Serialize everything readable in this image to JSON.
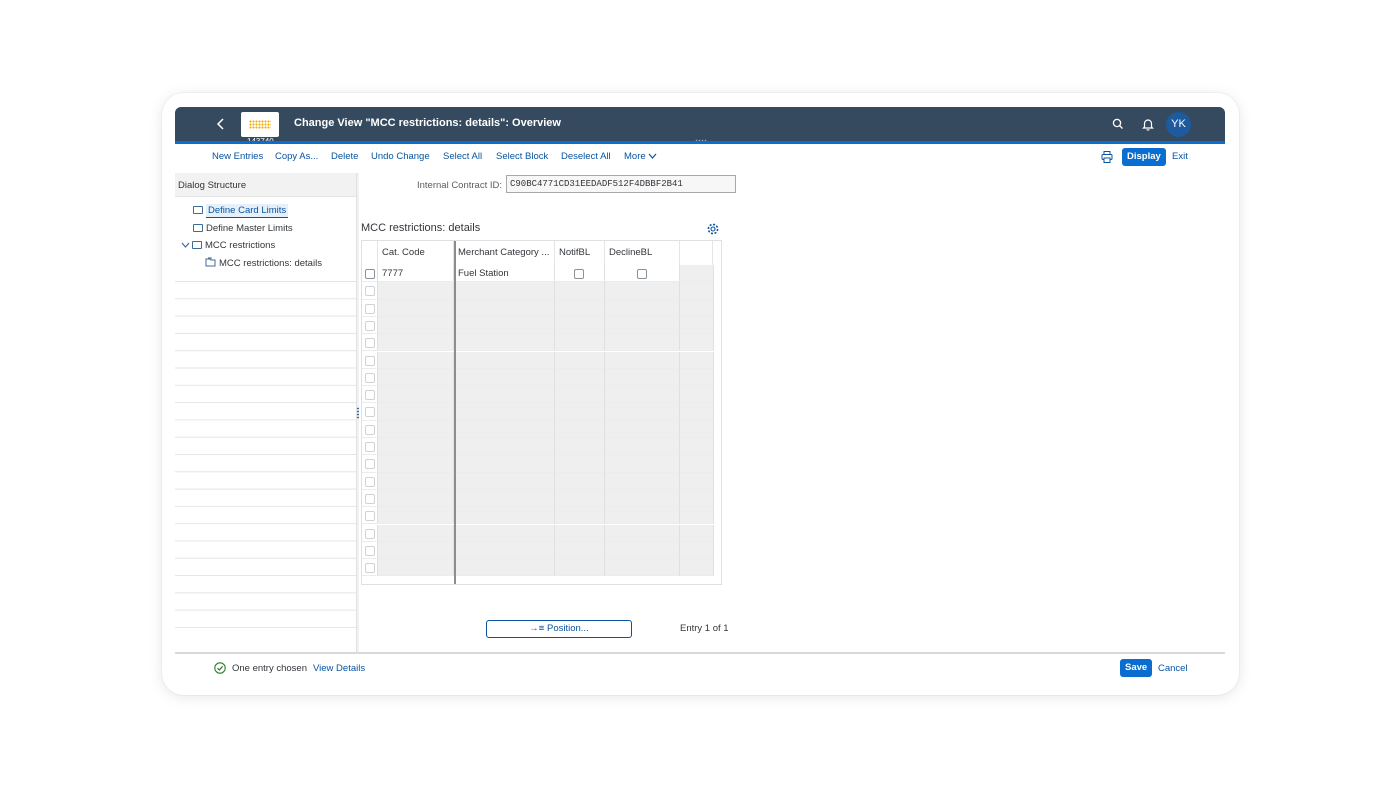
{
  "shell": {
    "title": "Change View \"MCC restrictions: details\": Overview",
    "logo_subtext": "143740",
    "avatar_initials": "YK",
    "colors": {
      "shellbar": "#354a5f",
      "accent": "#0a6ed1",
      "avatar": "#1d5a9e"
    },
    "icons": [
      "back-icon",
      "search-icon",
      "notification-bell-icon"
    ]
  },
  "toolbar": {
    "new_entries": "New Entries",
    "copy_as": "Copy As...",
    "delete": "Delete",
    "undo_change": "Undo Change",
    "select_all": "Select All",
    "select_block": "Select Block",
    "deselect_all": "Deselect All",
    "more": "More",
    "display": "Display",
    "exit": "Exit"
  },
  "dialog_structure": {
    "title": "Dialog Structure",
    "items": [
      {
        "label": "Define Card Limits",
        "selected": true
      },
      {
        "label": "Define Master Limits"
      },
      {
        "label": "MCC restrictions",
        "expanded": true
      },
      {
        "label": "MCC restrictions: details"
      }
    ]
  },
  "contract": {
    "label": "Internal Contract ID:",
    "value": "C90BC4771CD31EEDADF512F4DBBF2B41"
  },
  "table": {
    "title": "MCC restrictions: details",
    "columns": [
      "Cat. Code",
      "Merchant Category ...",
      "NotifBL",
      "DeclineBL"
    ],
    "rows": [
      {
        "cat_code": "7777",
        "merchant_category": "Fuel Station",
        "notif_bl": false,
        "decline_bl": false
      }
    ],
    "empty_row_count": 17
  },
  "position_button": "Position...",
  "entry_info": "Entry 1 of 1",
  "footer": {
    "message": "One entry chosen",
    "view_details": "View Details",
    "save": "Save",
    "cancel": "Cancel"
  }
}
